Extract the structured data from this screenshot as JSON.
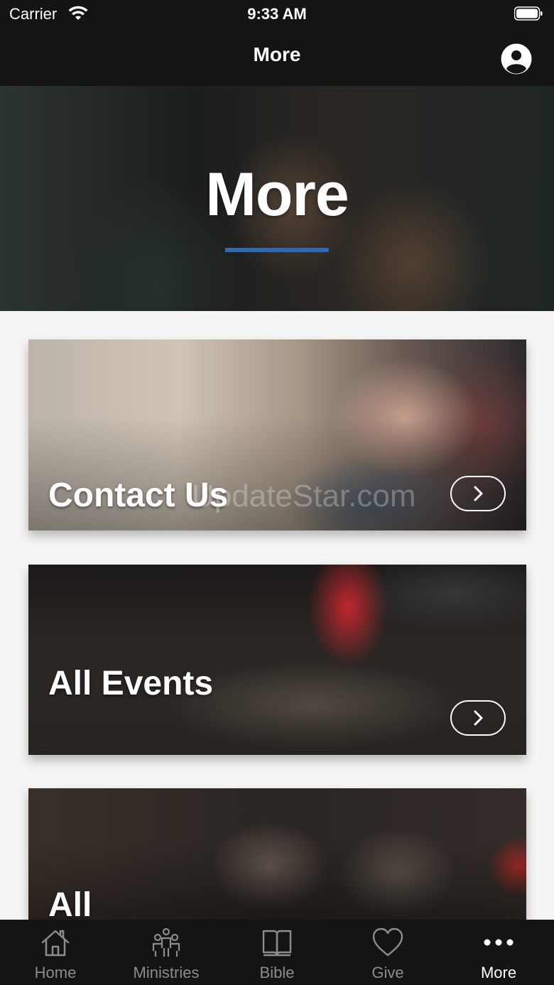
{
  "status_bar": {
    "carrier": "Carrier",
    "time": "9:33 AM"
  },
  "header": {
    "title": "More",
    "profile_icon": "person-circle-icon"
  },
  "hero": {
    "title": "More",
    "accent_color": "#2f68b4"
  },
  "cards": [
    {
      "label": "Contact Us",
      "action_icon": "chevron-right-icon"
    },
    {
      "label": "All Events",
      "action_icon": "chevron-right-icon"
    },
    {
      "label": "All"
    }
  ],
  "watermark": "UpdateStar.com",
  "tab_bar": {
    "items": [
      {
        "label": "Home",
        "icon": "home-icon"
      },
      {
        "label": "Ministries",
        "icon": "people-icon"
      },
      {
        "label": "Bible",
        "icon": "book-icon"
      },
      {
        "label": "Give",
        "icon": "heart-icon"
      },
      {
        "label": "More",
        "icon": "more-dots-icon"
      }
    ],
    "active": "More"
  }
}
